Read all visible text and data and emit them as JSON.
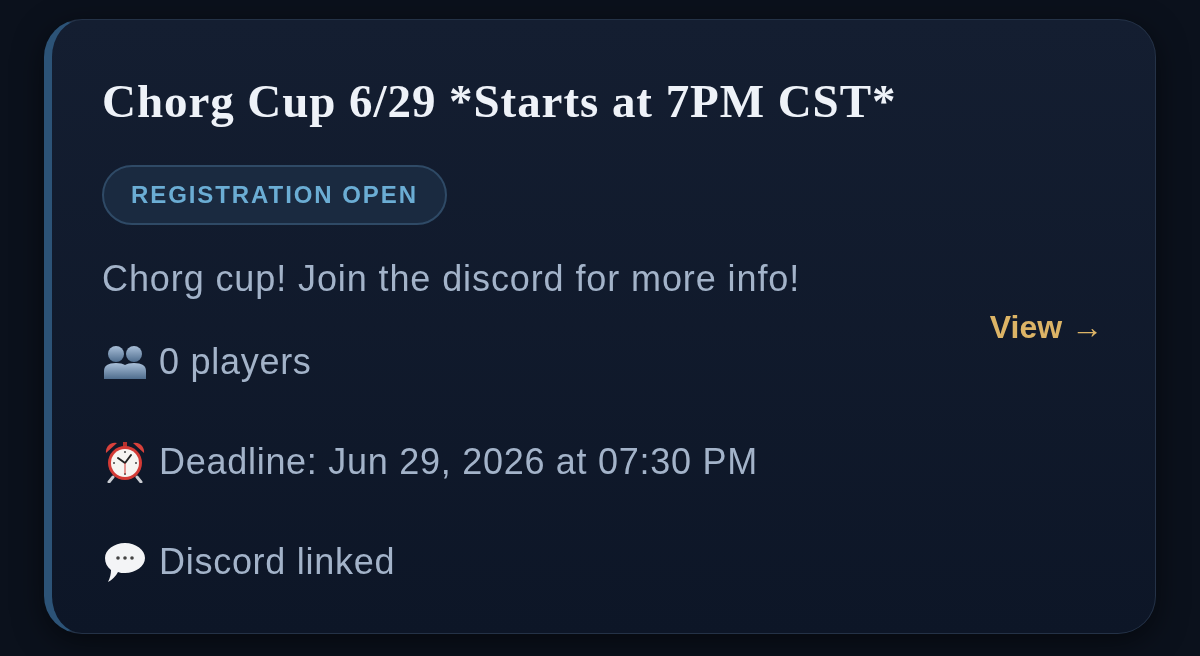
{
  "card": {
    "title": "Chorg Cup 6/29 *Starts at 7PM CST*",
    "status_badge": {
      "label": "REGISTRATION OPEN",
      "kind": "open"
    },
    "description": "Chorg cup! Join the discord for more info!",
    "view_link": {
      "label": "View →"
    },
    "details": [
      {
        "kind": "players",
        "text": "0 players"
      },
      {
        "kind": "deadline",
        "text": "Deadline: Jun 29, 2026 at 07:30 PM"
      },
      {
        "kind": "discord",
        "text": "Discord linked"
      }
    ]
  }
}
